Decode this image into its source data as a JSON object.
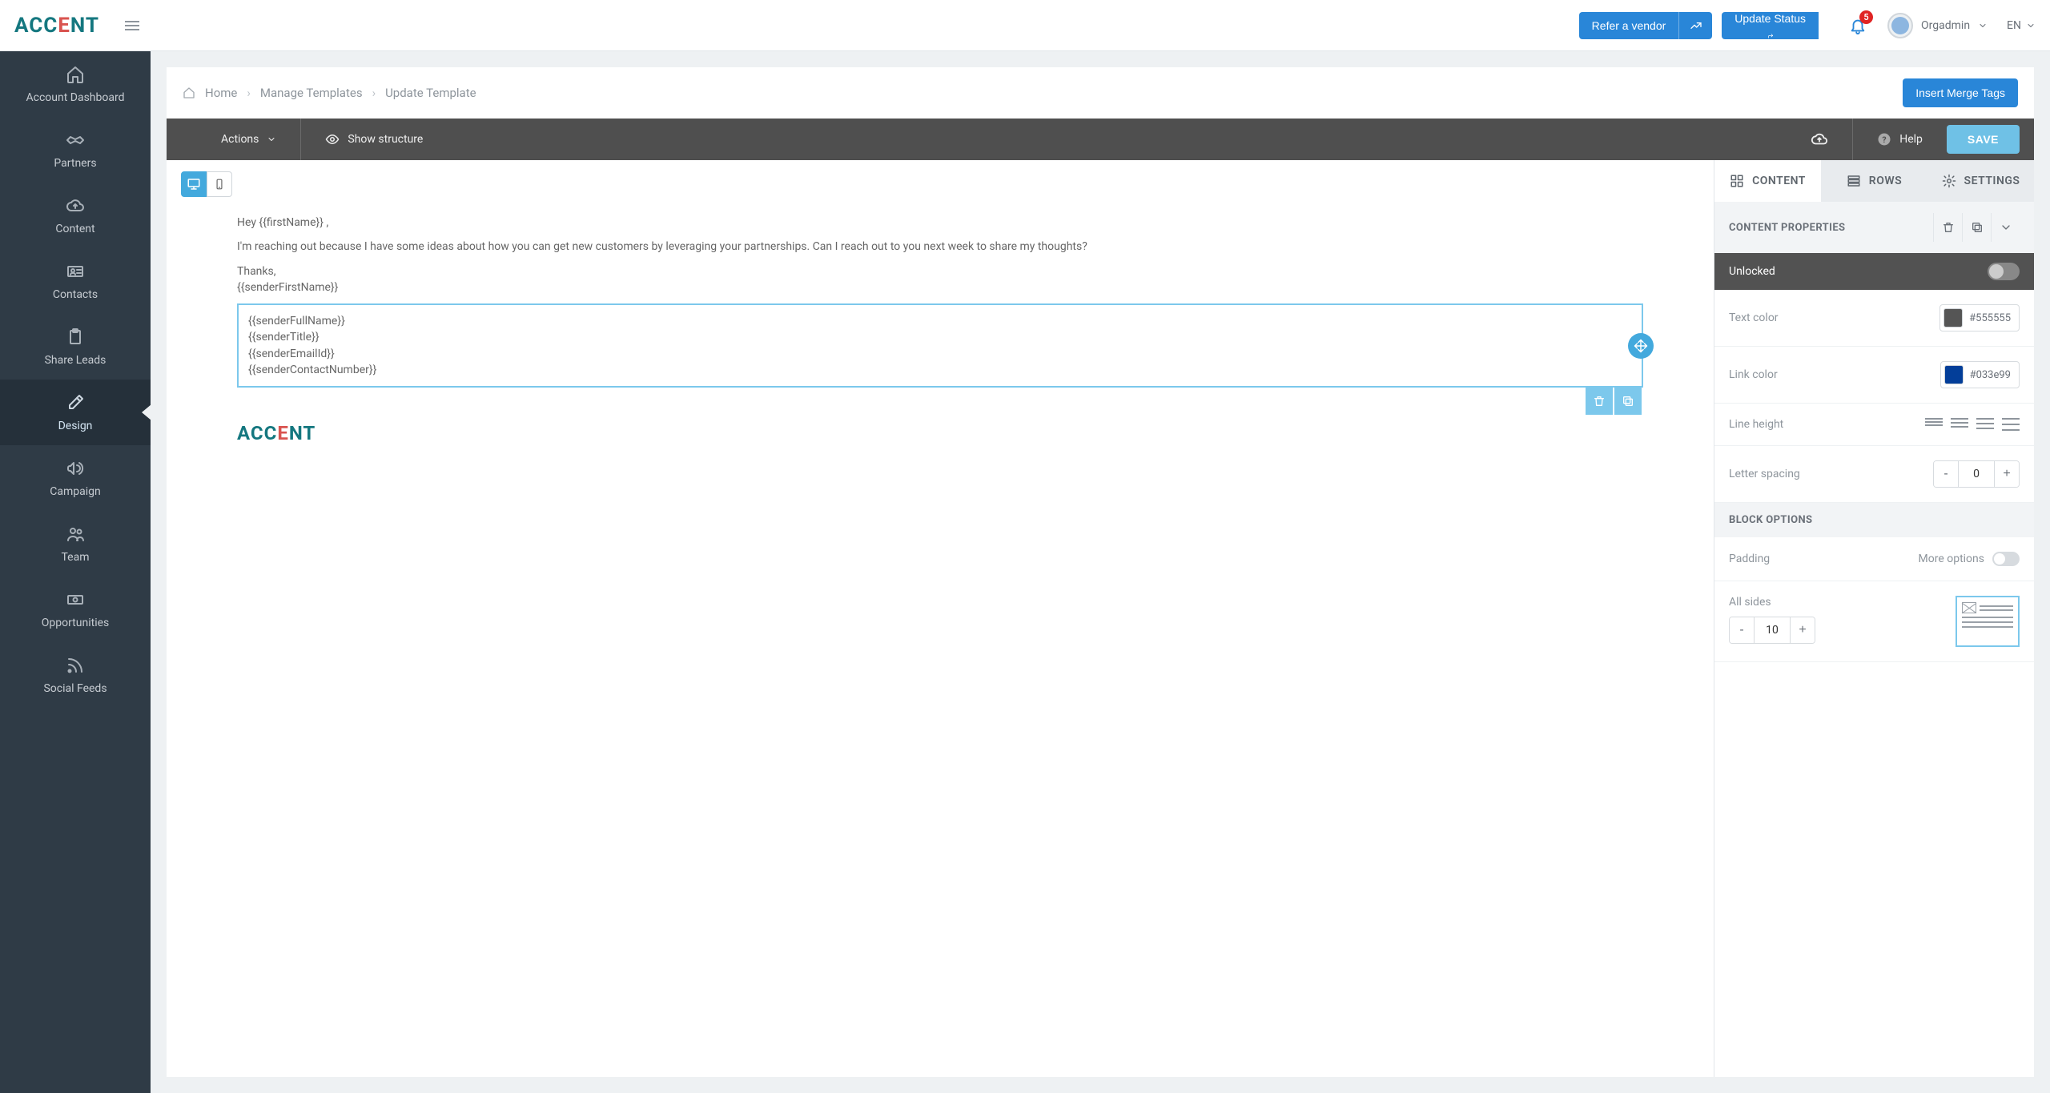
{
  "header": {
    "logo": "ACCENT",
    "refer_label": "Refer a vendor",
    "update_status_label": "Update Status",
    "notification_count": "5",
    "user_name": "Orgadmin",
    "lang": "EN"
  },
  "sidebar": {
    "items": [
      {
        "label": "Account Dashboard",
        "icon": "home"
      },
      {
        "label": "Partners",
        "icon": "handshake"
      },
      {
        "label": "Content",
        "icon": "cloud-up"
      },
      {
        "label": "Contacts",
        "icon": "id-card"
      },
      {
        "label": "Share Leads",
        "icon": "clipboard"
      },
      {
        "label": "Design",
        "icon": "brush",
        "active": true
      },
      {
        "label": "Campaign",
        "icon": "megaphone"
      },
      {
        "label": "Team",
        "icon": "users"
      },
      {
        "label": "Opportunities",
        "icon": "money"
      },
      {
        "label": "Social Feeds",
        "icon": "rss"
      }
    ]
  },
  "breadcrumb": {
    "home": "Home",
    "manage": "Manage Templates",
    "current": "Update Template",
    "insert_merge": "Insert Merge Tags"
  },
  "toolbar": {
    "actions": "Actions",
    "show_structure": "Show structure",
    "help": "Help",
    "save": "SAVE"
  },
  "email": {
    "greeting": "Hey {{firstName}} ,",
    "body": "I'm reaching out because I have some ideas about how you can get new customers by leveraging your partnerships. Can I reach out to you next week to share my thoughts?",
    "thanks": "Thanks,",
    "sender_first": "{{senderFirstName}}",
    "sig_line1": "{{senderFullName}}",
    "sig_line2": "{{senderTitle}}",
    "sig_line3": "{{senderEmailId}}",
    "sig_line4": "{{senderContactNumber}}",
    "brand": "ACCENT"
  },
  "panel": {
    "tabs": {
      "content": "CONTENT",
      "rows": "ROWS",
      "settings": "SETTINGS"
    },
    "section_title": "CONTENT PROPERTIES",
    "unlocked": "Unlocked",
    "text_color": {
      "label": "Text color",
      "value": "#555555"
    },
    "link_color": {
      "label": "Link color",
      "value": "#033e99"
    },
    "line_height_label": "Line height",
    "letter_spacing": {
      "label": "Letter spacing",
      "value": "0"
    },
    "block_options": "BLOCK OPTIONS",
    "padding_label": "Padding",
    "more_options": "More options",
    "all_sides": {
      "label": "All sides",
      "value": "10"
    }
  }
}
